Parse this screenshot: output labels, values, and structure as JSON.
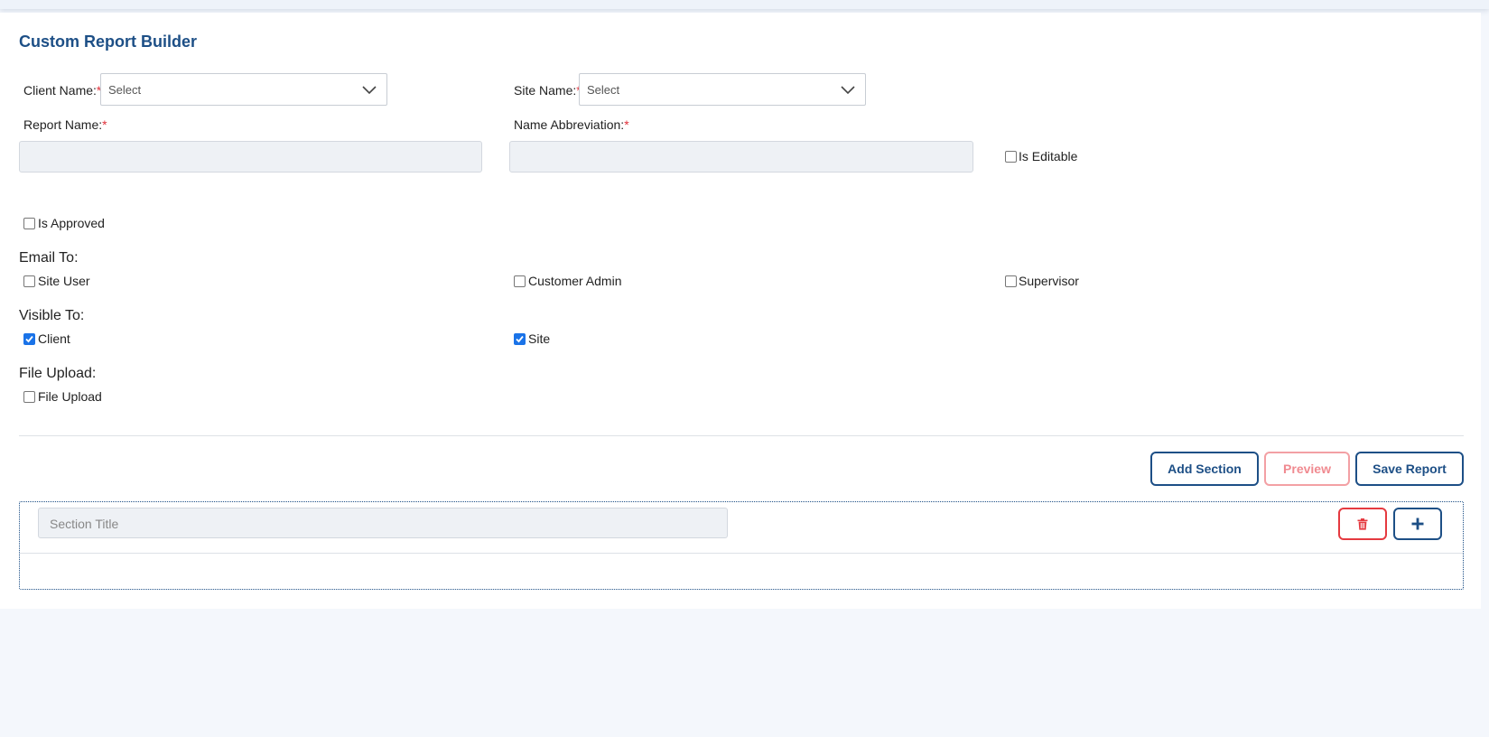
{
  "page": {
    "title": "Custom Report Builder"
  },
  "form": {
    "client_name": {
      "label": "Client Name:",
      "required": "*",
      "value": "Select"
    },
    "site_name": {
      "label": "Site Name:",
      "required": "*",
      "value": "Select"
    },
    "report_name": {
      "label": "Report Name:",
      "required": "*",
      "value": ""
    },
    "name_abbreviation": {
      "label": "Name Abbreviation:",
      "required": "*",
      "value": ""
    },
    "is_editable": {
      "label": "Is Editable",
      "checked": false
    },
    "is_approved": {
      "label": "Is Approved",
      "checked": false
    }
  },
  "email_to": {
    "heading": "Email To:",
    "options": [
      {
        "label": "Site User",
        "checked": false
      },
      {
        "label": "Customer Admin",
        "checked": false
      },
      {
        "label": "Supervisor",
        "checked": false
      }
    ]
  },
  "visible_to": {
    "heading": "Visible To:",
    "options": [
      {
        "label": "Client",
        "checked": true
      },
      {
        "label": "Site",
        "checked": true
      }
    ]
  },
  "file_upload": {
    "heading": "File Upload:",
    "option": {
      "label": "File Upload",
      "checked": false
    }
  },
  "actions": {
    "add_section": "Add Section",
    "preview": "Preview",
    "save_report": "Save Report"
  },
  "section": {
    "title_placeholder": "Section Title",
    "delete_icon": "trash-icon",
    "add_icon": "plus-icon"
  },
  "colors": {
    "primary": "#1d4f86",
    "danger": "#e53a40",
    "required": "#e0303a",
    "checkbox_checked": "#1a73e8"
  }
}
